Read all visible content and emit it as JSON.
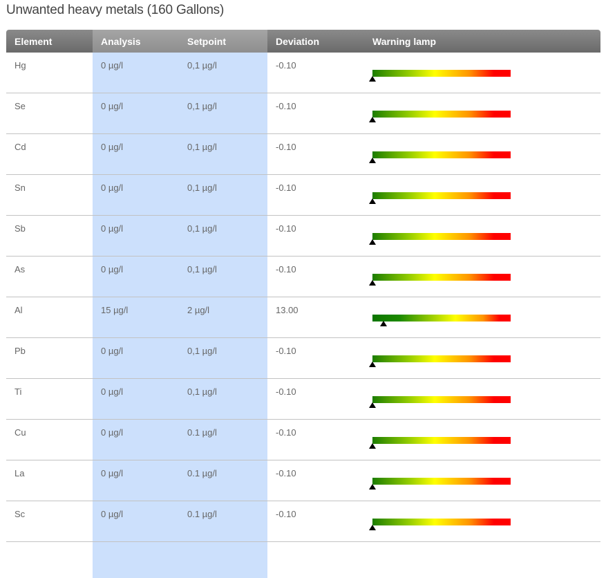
{
  "title": "Unwanted heavy metals (160 Gallons)",
  "headers": {
    "element": "Element",
    "analysis": "Analysis",
    "setpoint": "Setpoint",
    "deviation": "Deviation",
    "warning_lamp": "Warning lamp"
  },
  "rows": [
    {
      "element": "Hg",
      "analysis": "0 µg/l",
      "setpoint": "0,1 µg/l",
      "deviation": "-0.10",
      "lamp_level": 0.0
    },
    {
      "element": "Se",
      "analysis": "0 µg/l",
      "setpoint": "0,1 µg/l",
      "deviation": "-0.10",
      "lamp_level": 0.0
    },
    {
      "element": "Cd",
      "analysis": "0 µg/l",
      "setpoint": "0,1 µg/l",
      "deviation": "-0.10",
      "lamp_level": 0.0
    },
    {
      "element": "Sn",
      "analysis": "0 µg/l",
      "setpoint": "0,1 µg/l",
      "deviation": "-0.10",
      "lamp_level": 0.0
    },
    {
      "element": "Sb",
      "analysis": "0 µg/l",
      "setpoint": "0,1 µg/l",
      "deviation": "-0.10",
      "lamp_level": 0.0
    },
    {
      "element": "As",
      "analysis": "0 µg/l",
      "setpoint": "0,1 µg/l",
      "deviation": "-0.10",
      "lamp_level": 0.0
    },
    {
      "element": "Al",
      "analysis": "15 µg/l",
      "setpoint": "2 µg/l",
      "deviation": "13.00",
      "lamp_level": 0.08
    },
    {
      "element": "Pb",
      "analysis": "0 µg/l",
      "setpoint": "0,1 µg/l",
      "deviation": "-0.10",
      "lamp_level": 0.0
    },
    {
      "element": "Ti",
      "analysis": "0 µg/l",
      "setpoint": "0,1 µg/l",
      "deviation": "-0.10",
      "lamp_level": 0.0
    },
    {
      "element": "Cu",
      "analysis": "0 µg/l",
      "setpoint": "0.1 µg/l",
      "deviation": "-0.10",
      "lamp_level": 0.0
    },
    {
      "element": "La",
      "analysis": "0 µg/l",
      "setpoint": "0.1 µg/l",
      "deviation": "-0.10",
      "lamp_level": 0.0
    },
    {
      "element": "Sc",
      "analysis": "0 µg/l",
      "setpoint": "0.1 µg/l",
      "deviation": "-0.10",
      "lamp_level": 0.0
    }
  ]
}
